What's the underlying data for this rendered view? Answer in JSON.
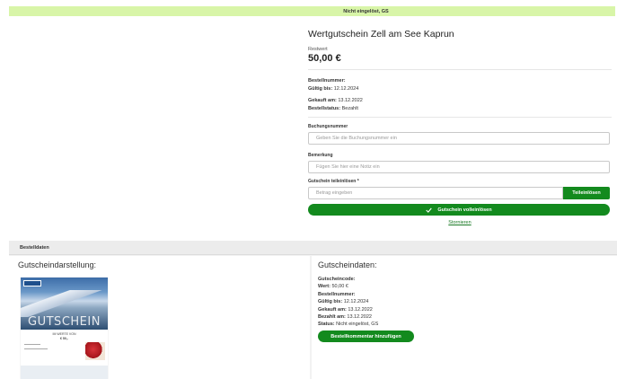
{
  "banner": {
    "status": "Nicht eingelöst, GS"
  },
  "product": {
    "title": "Wertgutschein Zell am See Kaprun",
    "value_label": "Restwert",
    "value": "50,00 €"
  },
  "order": {
    "number_label": "Bestellnummer:",
    "valid_label": "Gültig bis:",
    "valid_value": "12.12.2024",
    "bought_label": "Gekauft am:",
    "bought_value": "13.12.2022",
    "status_label": "Bestellstatus:",
    "status_value": "Bezahlt"
  },
  "form": {
    "booking_label": "Buchungsnummer",
    "booking_placeholder": "Geben Sie die Buchungsnummer ein",
    "note_label": "Bemerkung",
    "note_placeholder": "Fügen Sie hier eine Notiz ein",
    "partial_label": "Gutschein teileinlösen *",
    "partial_placeholder": "Betrag eingeben",
    "partial_button": "Teileinlösen",
    "full_button": "Gutschein volleinlösen",
    "cancel_link": "Stornieren"
  },
  "section": {
    "header": "Bestelldaten",
    "left_title": "Gutscheindarstellung:",
    "right_title": "Gutscheindaten:"
  },
  "voucher_image": {
    "word": "GUTSCHEIN",
    "sub": "IM WERTE VON",
    "amount": "€ 50,-"
  },
  "details": {
    "code_label": "Gutscheincode:",
    "value_label": "Wert:",
    "value": "50,00 €",
    "number_label": "Bestellnummer:",
    "valid_label": "Gültig bis:",
    "valid_value": "12.12.2024",
    "bought_label": "Gekauft am:",
    "bought_value": "13.12.2022",
    "paid_label": "Bezahlt am:",
    "paid_value": "13.12.2022",
    "status_label": "Status:",
    "status_value": "Nicht eingelöst, GS",
    "comment_button": "Bestellkommentar hinzufügen"
  },
  "colors": {
    "accent": "#138a1e",
    "banner": "#d8f5a8"
  }
}
